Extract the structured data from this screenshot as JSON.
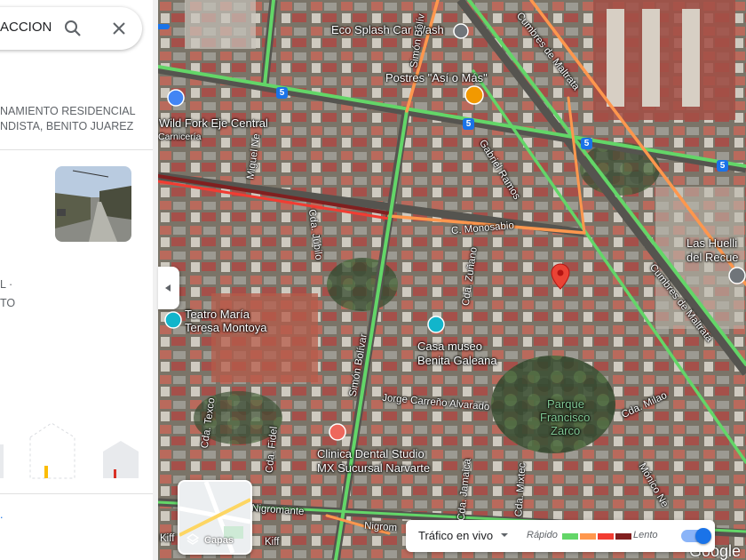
{
  "search": {
    "value": "ACCION"
  },
  "place": {
    "address_line1": "NAMIENTO RESIDENCIAL",
    "address_line2": "NDISTA, BENITO JUAREZ",
    "frag1": "L ·",
    "frag2": "TO",
    "frag3": "."
  },
  "map": {
    "pois": [
      {
        "id": "eco-splash",
        "label": "Eco Splash Car Wash"
      },
      {
        "id": "postres",
        "label": "Postres \"Así o Más\""
      },
      {
        "id": "wild-fork",
        "label": "Wild Fork Eje Central"
      },
      {
        "id": "wild-fork-sub",
        "label": "Carnicería"
      },
      {
        "id": "teatro-1",
        "label": "Teatro María"
      },
      {
        "id": "teatro-2",
        "label": "Teresa Montoya"
      },
      {
        "id": "casa-1",
        "label": "Casa museo"
      },
      {
        "id": "casa-2",
        "label": "Benita Galeana"
      },
      {
        "id": "clinica-1",
        "label": "Clinica Dental Studio"
      },
      {
        "id": "clinica-2",
        "label": "MX Sucursal Narvarte"
      },
      {
        "id": "parque-1",
        "label": "Parque"
      },
      {
        "id": "parque-2",
        "label": "Francisco"
      },
      {
        "id": "parque-3",
        "label": "Zarco"
      },
      {
        "id": "huellitas-1",
        "label": "Las Huelli"
      },
      {
        "id": "huellitas-2",
        "label": "del Recue"
      }
    ],
    "streets": {
      "cumbres_top": "Cumbres de Maltrata",
      "cumbres_mid": "Cumbres de Maltrata",
      "miguel": "Miguel Ne",
      "simon_top": "Simón Bolív",
      "simon_mid": "Simón Bolívar",
      "gabriel": "Gabriel Ramos",
      "monosabio": "C. Monosabio",
      "jubilo": "Cda. Júbilo",
      "zuñano": "Cda. Zuñano",
      "jorge": "Jorge Carreño Alvarado",
      "texco": "Cda. Texco",
      "fidel": "Cda. Fidel",
      "nigromante1": "Nigromante",
      "nigromante2": "Nigrom",
      "kiff1": "Kiff",
      "kiff2": "Kiff",
      "mixtec": "Cda. Mixtec",
      "monico": "Mónico Ne",
      "miltao": "Cda. Milao",
      "jamaica": "Cda. Jamaica"
    },
    "route_badges": [
      "5",
      "5",
      "5",
      "5"
    ],
    "layers_label": "Capas"
  },
  "traffic": {
    "dropdown_label": "Tráfico en vivo",
    "fast_label": "Rápido",
    "slow_label": "Lento",
    "colors": [
      "#63d668",
      "#ff974d",
      "#f23c32",
      "#811f1f"
    ]
  },
  "brand": {
    "logo_text": "Google"
  }
}
